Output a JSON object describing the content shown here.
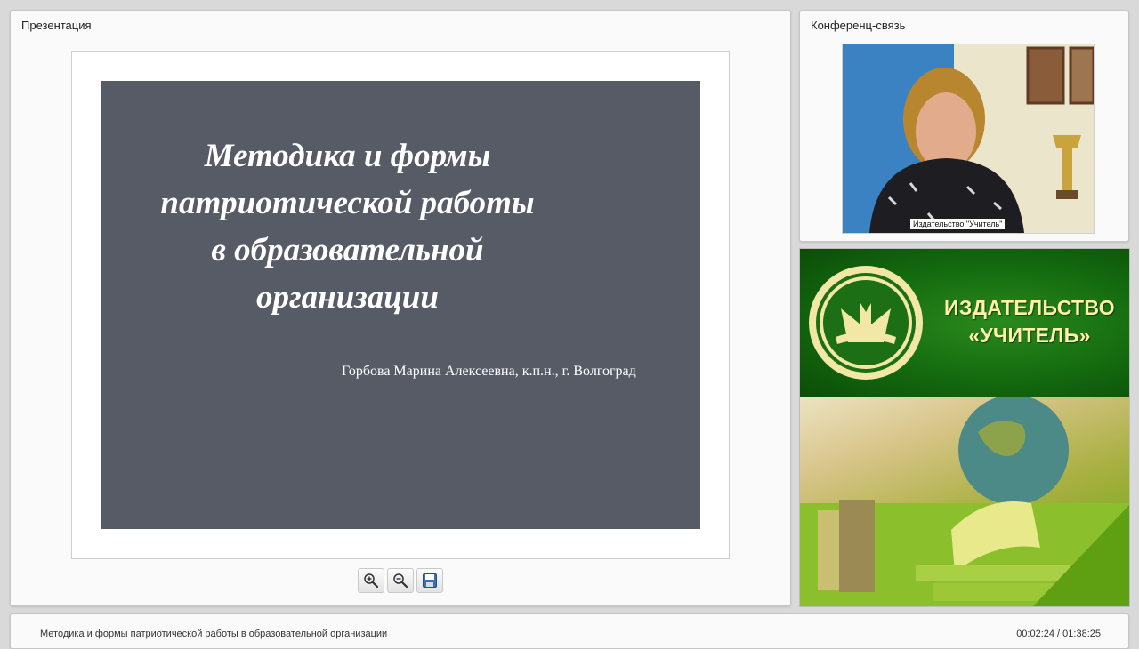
{
  "presentation": {
    "panel_title": "Презентация",
    "slide": {
      "title_lines": [
        "Методика и формы",
        "патриотической работы",
        "в образовательной",
        "организации"
      ],
      "author": "Горбова Марина Алексеевна, к.п.н., г. Волгоград",
      "background": "#575b66"
    },
    "toolbar": {
      "zoom_in_icon": "zoom-in-icon",
      "zoom_out_icon": "zoom-out-icon",
      "save_icon": "floppy-disk-icon"
    }
  },
  "video": {
    "panel_title": "Конференц-связь",
    "caption": "Издательство \"Учитель\""
  },
  "banner": {
    "name": "ИЗДАТЕЛЬСТВО",
    "sub": "«УЧИТЕЛЬ»",
    "accent": "#1e7a15",
    "text_color": "#fff2a8"
  },
  "footer": {
    "title": "Методика и формы патриотической работы в образовательной организации",
    "time": "00:02:24 / 01:38:25"
  }
}
